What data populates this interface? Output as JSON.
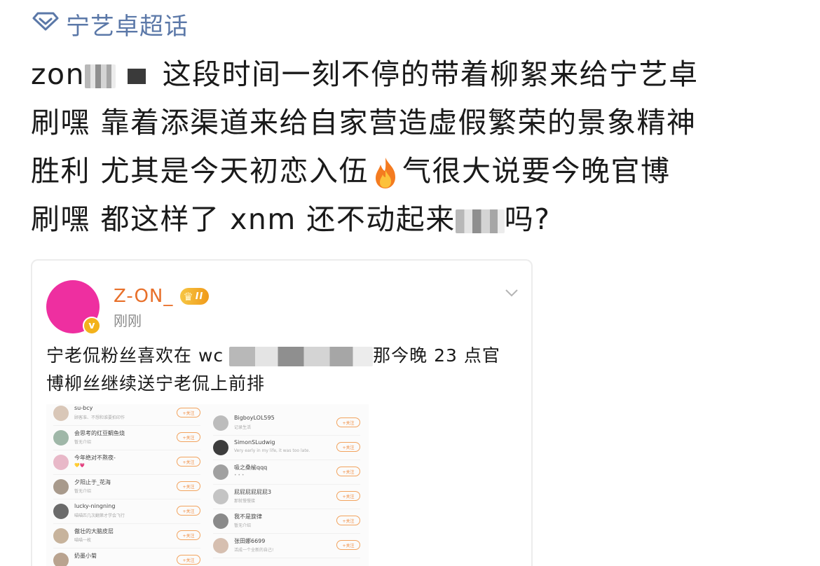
{
  "topic": {
    "icon": "diamond-icon",
    "label": "宁艺卓超话",
    "color": "#5b78a8"
  },
  "post": {
    "line1_a": "zon",
    "line1_b": " 这段时间一刻不停的带着柳絮来给宁艺卓",
    "line2": "刷嘿  靠着添渠道来给自家营造虚假繁荣的景象精神",
    "line3_a": "胜利  尤其是今天初恋入伍",
    "line3_b": "气很大说要今晚官博",
    "line4_a": "刷嘿 都这样了 xnm 还不动起来",
    "line4_b": "吗?"
  },
  "card": {
    "username": "Z-ON_",
    "level": "II",
    "time": "刚刚",
    "verified_badge": "v",
    "text_line1_a": "宁老侃粉丝喜欢在 wc",
    "text_line1_b": "那今晚 23 点官",
    "text_line2": "博柳丝继续送宁老侃上前排",
    "avatar_color": "#ee2fa0",
    "name_color": "#e8702a"
  },
  "screenshot": {
    "follow_label": "+关注",
    "left": [
      {
        "name": "su-bcy",
        "sub": "顾客准、不想和谁要拍印作"
      },
      {
        "name": "会思考的红豆鲷鱼烧",
        "sub": "暂无介绍"
      },
      {
        "name": "今年绝对不熬夜-",
        "sub": "💛💗"
      },
      {
        "name": "夕阳止于_花海",
        "sub": "暂无介绍"
      },
      {
        "name": "lucky-ningning",
        "sub": "喵喵匹几次翻第才学会飞行"
      },
      {
        "name": "傲壮的大脑皮层",
        "sub": "喵喵一枚"
      },
      {
        "name": "奶墨小菊",
        "sub": ""
      }
    ],
    "right": [
      {
        "name": "BigboyLOL595",
        "sub": "记录生活"
      },
      {
        "name": "SimonSLudwig",
        "sub": "Very early in my life, it was too late."
      },
      {
        "name": "吸之桑榆qqq",
        "sub": "• • •"
      },
      {
        "name": "屁屁屁屁屁屁3",
        "sub": "那就慢慢接"
      },
      {
        "name": "我不是旋律",
        "sub": "暂无介绍"
      },
      {
        "name": "张田娜6699",
        "sub": "活成一个全新的自己!"
      }
    ]
  }
}
